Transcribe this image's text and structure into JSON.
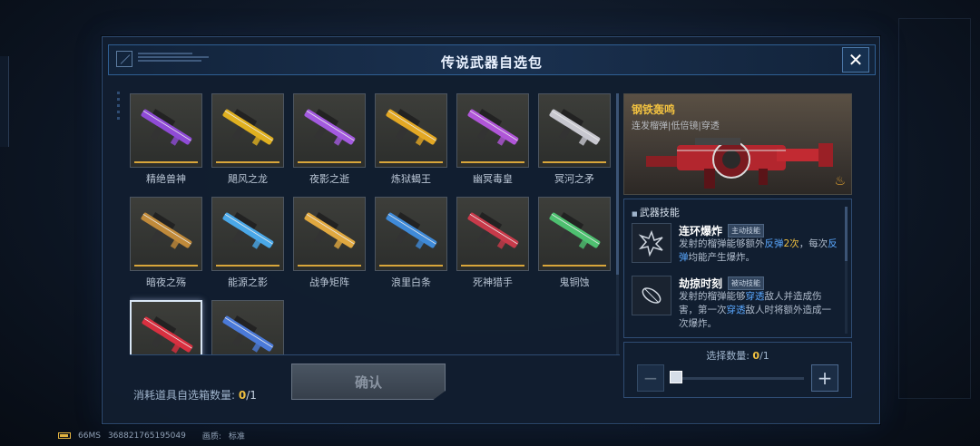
{
  "dialog": {
    "title": "传说武器自选包",
    "close_label": "✕"
  },
  "weapons": [
    {
      "name": "精绝兽神",
      "color": "#8f4bd6"
    },
    {
      "name": "飓风之龙",
      "color": "#e0b020"
    },
    {
      "name": "夜影之逝",
      "color": "#a35adf"
    },
    {
      "name": "炼狱蝎王",
      "color": "#e3a824"
    },
    {
      "name": "幽冥毒皇",
      "color": "#b056d8"
    },
    {
      "name": "冥河之矛",
      "color": "#c7c7cf"
    },
    {
      "name": "暗夜之殇",
      "color": "#c08a3a"
    },
    {
      "name": "能源之影",
      "color": "#4aa8e8"
    },
    {
      "name": "战争矩阵",
      "color": "#e0a840"
    },
    {
      "name": "浪里白条",
      "color": "#3f8ad8"
    },
    {
      "name": "死神猎手",
      "color": "#c83a4a"
    },
    {
      "name": "鬼铜蚀",
      "color": "#4ec070"
    },
    {
      "name": "",
      "color": "#d83040"
    },
    {
      "name": "",
      "color": "#4b7ad8"
    }
  ],
  "selected_index": 12,
  "consume": {
    "label": "消耗道具自选箱数量:",
    "current": "0",
    "total": "/1"
  },
  "confirm_label": "确认",
  "detail": {
    "name": "钢铁轰鸣",
    "tags": "连发榴弹|低倍镜|穿透",
    "section_title": "武器技能",
    "skills": [
      {
        "name": "连环爆炸",
        "type": "主动技能",
        "desc_parts": [
          "发射的榴弹能够额外",
          "反弹",
          "2次",
          "，每次",
          "反弹",
          "均能产生爆炸。"
        ]
      },
      {
        "name": "劫掠时刻",
        "type": "被动技能",
        "desc_parts": [
          "发射的榴弹能够",
          "穿透",
          "敌人并造成伤害，第一次",
          "穿透",
          "敌人时将额外造成一次爆炸。"
        ]
      }
    ]
  },
  "quantity": {
    "label": "选择数量:",
    "current": "0",
    "total": "/1",
    "value": 0,
    "max": 1,
    "minus": "−",
    "plus": "+"
  },
  "status": {
    "ping": "66MS",
    "id": "368821765195049",
    "quality_label": "画质:",
    "quality": "标准"
  }
}
